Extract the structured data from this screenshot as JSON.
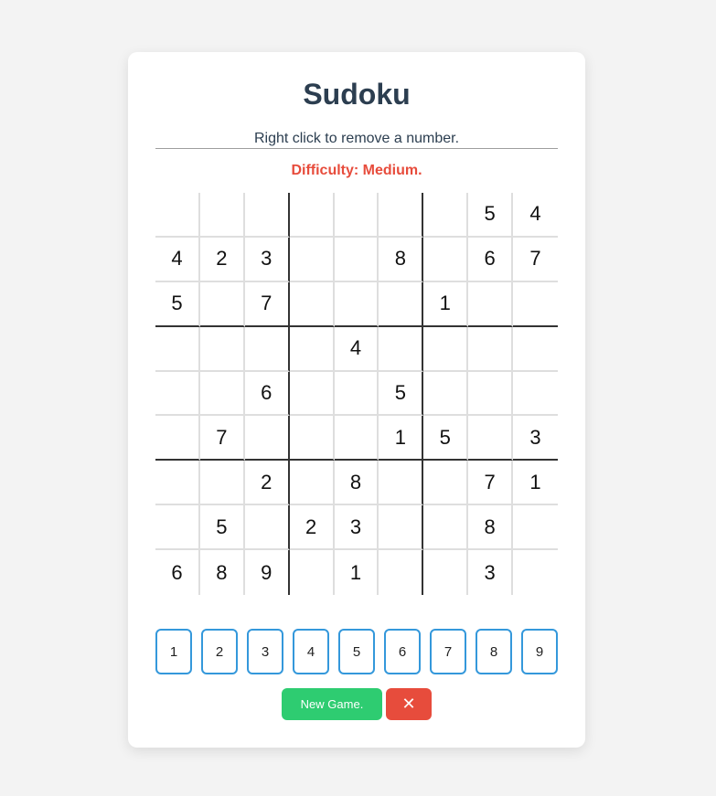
{
  "header": {
    "title": "Sudoku",
    "instructions": "Right click to remove a number.",
    "difficulty": "Difficulty: Medium."
  },
  "board": {
    "rows": [
      [
        "",
        "",
        "",
        "",
        "",
        "",
        "",
        "5",
        "4"
      ],
      [
        "4",
        "2",
        "3",
        "",
        "",
        "8",
        "",
        "6",
        "7"
      ],
      [
        "5",
        "",
        "7",
        "",
        "",
        "",
        "1",
        "",
        ""
      ],
      [
        "",
        "",
        "",
        "",
        "4",
        "",
        "",
        "",
        ""
      ],
      [
        "",
        "",
        "6",
        "",
        "",
        "5",
        "",
        "",
        ""
      ],
      [
        "",
        "7",
        "",
        "",
        "",
        "1",
        "5",
        "",
        "3"
      ],
      [
        "",
        "",
        "2",
        "",
        "8",
        "",
        "",
        "7",
        "1"
      ],
      [
        "",
        "5",
        "",
        "2",
        "3",
        "",
        "",
        "8",
        ""
      ],
      [
        "6",
        "8",
        "9",
        "",
        "1",
        "",
        "",
        "3",
        ""
      ]
    ]
  },
  "numpad": {
    "numbers": [
      "1",
      "2",
      "3",
      "4",
      "5",
      "6",
      "7",
      "8",
      "9"
    ]
  },
  "actions": {
    "new_game_label": "New Game.",
    "close_label": "✕"
  },
  "colors": {
    "title": "#2c3e50",
    "difficulty": "#e74c3c",
    "numpad_border": "#3498db",
    "new_game": "#2ecc71",
    "close": "#e74c3c"
  }
}
